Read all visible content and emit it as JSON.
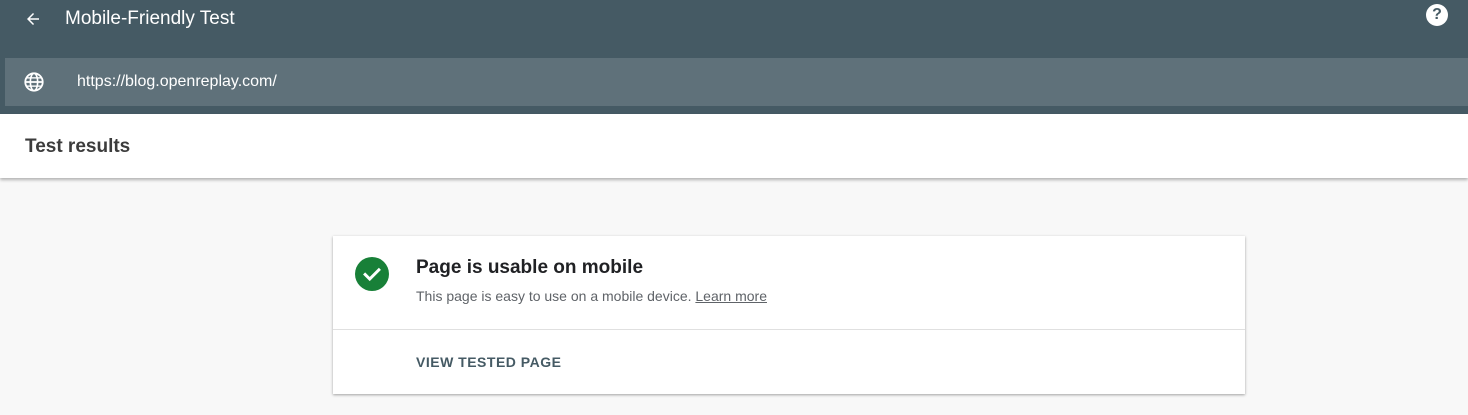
{
  "appbar": {
    "title": "Mobile-Friendly Test",
    "back_icon": "arrow-back-icon",
    "help_icon": "help-icon",
    "background": "#455a64"
  },
  "urlbar": {
    "icon": "globe-icon",
    "url": "https://blog.openreplay.com/"
  },
  "results": {
    "title": "Test results"
  },
  "card": {
    "status_icon": "check-circle-icon",
    "status_color": "#188038",
    "verdict": "Page is usable on mobile",
    "description": "This page is easy to use on a mobile device.",
    "learn_more": "Learn more",
    "view_button": "VIEW TESTED PAGE"
  }
}
